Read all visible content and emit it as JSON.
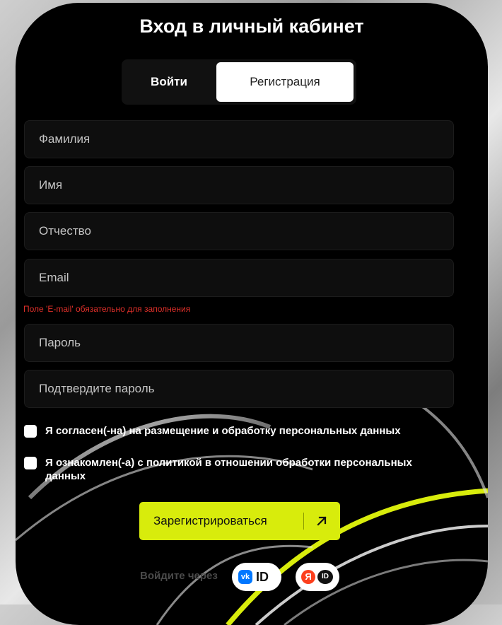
{
  "page": {
    "title": "Вход в личный кабинет"
  },
  "tabs": {
    "login": "Войти",
    "register": "Регистрация"
  },
  "form": {
    "last_name": "Фамилия",
    "first_name": "Имя",
    "patronymic": "Отчество",
    "email": "Email",
    "email_error": "Поле 'E-mail' обязательно для заполнения",
    "password": "Пароль",
    "confirm_password": "Подтвердите пароль"
  },
  "consents": {
    "personal_data": "Я согласен(-на) на размещение и обработку персональных данных",
    "policy": "Я ознакомлен(-а) с политикой в отношении обработки персональных данных"
  },
  "submit": {
    "label": "Зарегистрироваться",
    "icon": "arrow-up-right-icon"
  },
  "social": {
    "via_label": "Войдите через",
    "vk_text": "ID",
    "yandex_text": "ID"
  },
  "colors": {
    "accent": "#d8ec0c",
    "error": "#e0302a",
    "card": "#000000",
    "vk": "#0077ff",
    "yandex": "#fc3f1d"
  }
}
